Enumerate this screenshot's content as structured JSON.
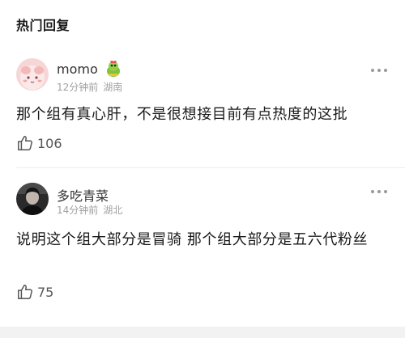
{
  "section": {
    "title": "热门回复"
  },
  "comments": [
    {
      "username": "momo",
      "time": "12分钟前",
      "location": "湖南",
      "text": "那个组有真心肝，不是很想接目前有点热度的这批",
      "likes": "106",
      "avatar": "pink-cartoon-avatar",
      "badge": "green-chick-badge-icon"
    },
    {
      "username": "多吃青菜",
      "time": "14分钟前",
      "location": "湖北",
      "text": "说明这个组大部分是冒骑 那个组大部分是五六代粉丝",
      "likes": "75",
      "avatar": "dark-photo-avatar"
    }
  ]
}
